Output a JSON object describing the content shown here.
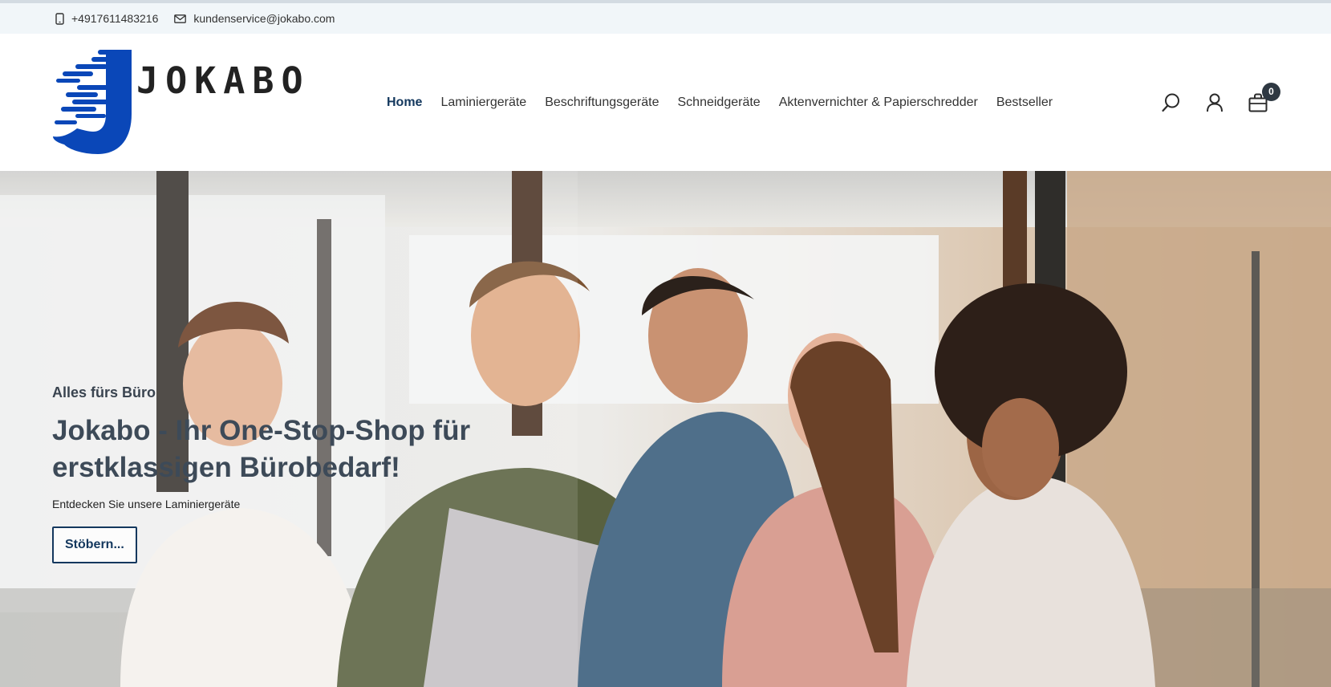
{
  "topbar": {
    "phone": "+4917611483216",
    "email": "kundenservice@jokabo.com",
    "phone_icon": "phone-icon",
    "email_icon": "mail-icon"
  },
  "logo": {
    "text": "JOKABO",
    "color": "#0a47b8"
  },
  "nav": {
    "items": [
      {
        "label": "Home",
        "active": true
      },
      {
        "label": "Laminiergeräte"
      },
      {
        "label": "Beschriftungsgeräte"
      },
      {
        "label": "Schneidgeräte"
      },
      {
        "label": "Aktenvernichter & Papierschredder"
      },
      {
        "label": "Bestseller"
      }
    ]
  },
  "header_icons": {
    "search_icon": "search-icon",
    "account_icon": "user-icon",
    "cart_icon": "cart-icon",
    "cart_count": "0"
  },
  "hero": {
    "eyebrow": "Alles fürs Büro",
    "title": "Jokabo - Ihr One-Stop-Shop für erstklassigen Bürobedarf!",
    "subtitle": "Entdecken Sie unsere Laminiergeräte",
    "cta_label": "Stöbern..."
  },
  "colors": {
    "accent": "#14385e",
    "topbar_bg": "#f1f6f9",
    "badge": "#2e3842"
  }
}
